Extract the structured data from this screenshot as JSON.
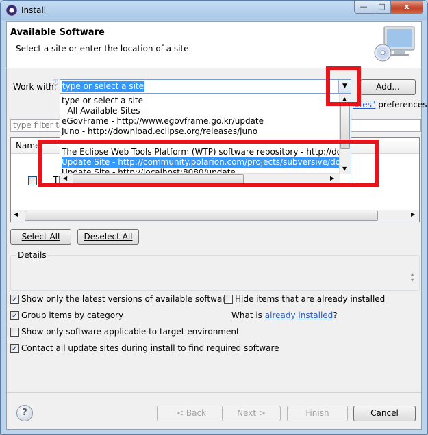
{
  "window": {
    "title": "Install",
    "min_glyph": "—",
    "max_glyph": "□",
    "close_glyph": "x"
  },
  "banner": {
    "title": "Available Software",
    "subtitle": "Select a site or enter the location of a site."
  },
  "work_with": {
    "label": "Work with:",
    "value": "type or select a site",
    "add_button": "Add..."
  },
  "dropdown_items": [
    "type or select a site",
    "--All Available Sites--",
    "eGovFrame - http://www.egovframe.go.kr/update",
    "Juno - http://download.eclipse.org/releases/juno",
    "The Eclipse Web Tools Platform (WTP) software repository - http://downloa",
    "Update Site - http://community.polarion.com/projects/subversive/downloa",
    "Update Site - http://localhost:8080/update"
  ],
  "selected_item_index": 5,
  "preferences_fragment": {
    "link_tail": "sites\"",
    "text": "preferences."
  },
  "filter": {
    "placeholder": "type filter tex"
  },
  "tree": {
    "column_name": "Name",
    "row_text": "Th"
  },
  "buttons": {
    "select_all": "Select All",
    "deselect_all": "Deselect All",
    "back": "< Back",
    "next": "Next >",
    "finish": "Finish",
    "cancel": "Cancel"
  },
  "details": {
    "label": "Details"
  },
  "options": {
    "latest_versions": {
      "label": "Show only the latest versions of available software",
      "checked": true
    },
    "hide_installed": {
      "label": "Hide items that are already installed",
      "checked": false
    },
    "group_by_category": {
      "label": "Group items by category",
      "checked": true
    },
    "target_env": {
      "label": "Show only software applicable to target environment",
      "checked": false
    },
    "contact_sites": {
      "label": "Contact all update sites during install to find required software",
      "checked": true
    }
  },
  "already_installed": {
    "prefix": "What is ",
    "link": "already installed",
    "suffix": "?"
  },
  "colors": {
    "selection": "#3399ff",
    "highlight_box": "#e8141c",
    "link": "#2b5fc4"
  }
}
